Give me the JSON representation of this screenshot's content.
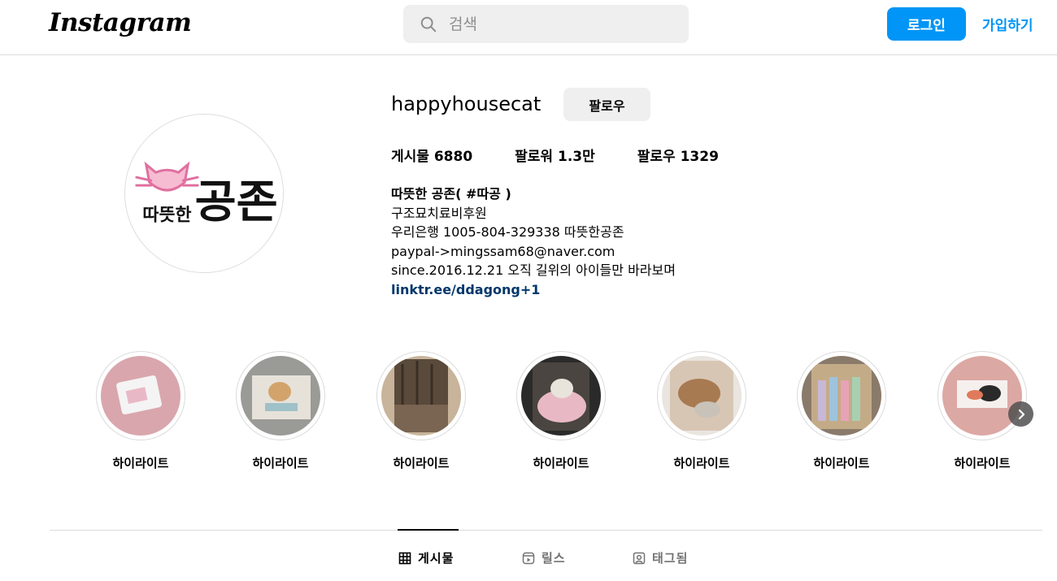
{
  "header": {
    "logo": "Instagram",
    "search_placeholder": "검색",
    "login_label": "로그인",
    "signup_label": "가입하기"
  },
  "profile": {
    "username": "happyhousecat",
    "follow_label": "팔로우",
    "stats": {
      "posts": "게시물 6880",
      "followers": "팔로워 1.3만",
      "following": "팔로우 1329"
    },
    "bio": {
      "name": "따뜻한 공존( #따공 )",
      "line1": "구조묘치료비후원",
      "line2": "우리은행 1005-804-329338 따뜻한공존",
      "line3": "paypal->mingssam68@naver.com",
      "line4": "since.2016.12.21 오직 길위의 아이들만 바라보며",
      "link": "linktr.ee/ddagong+1"
    },
    "avatar_text": {
      "main": "공존",
      "sub": "따뜻한"
    }
  },
  "highlights": [
    {
      "label": "하이라이트",
      "colors": [
        "#d9a6ad",
        "#f2f2f2"
      ]
    },
    {
      "label": "하이라이트",
      "colors": [
        "#9a9a96",
        "#e6d7c2"
      ]
    },
    {
      "label": "하이라이트",
      "colors": [
        "#5a4a3c",
        "#a88a6a"
      ]
    },
    {
      "label": "하이라이트",
      "colors": [
        "#2a2a2a",
        "#e8b9c4"
      ]
    },
    {
      "label": "하이라이트",
      "colors": [
        "#d8c6b4",
        "#a87a52"
      ]
    },
    {
      "label": "하이라이트",
      "colors": [
        "#8a7a6a",
        "#c9b7d6"
      ]
    },
    {
      "label": "하이라이트",
      "colors": [
        "#dca8a4",
        "#ffffff"
      ]
    }
  ],
  "tabs": [
    {
      "label": "게시물",
      "icon": "grid-icon",
      "active": true
    },
    {
      "label": "릴스",
      "icon": "reels-icon",
      "active": false
    },
    {
      "label": "태그됨",
      "icon": "tagged-icon",
      "active": false
    }
  ]
}
